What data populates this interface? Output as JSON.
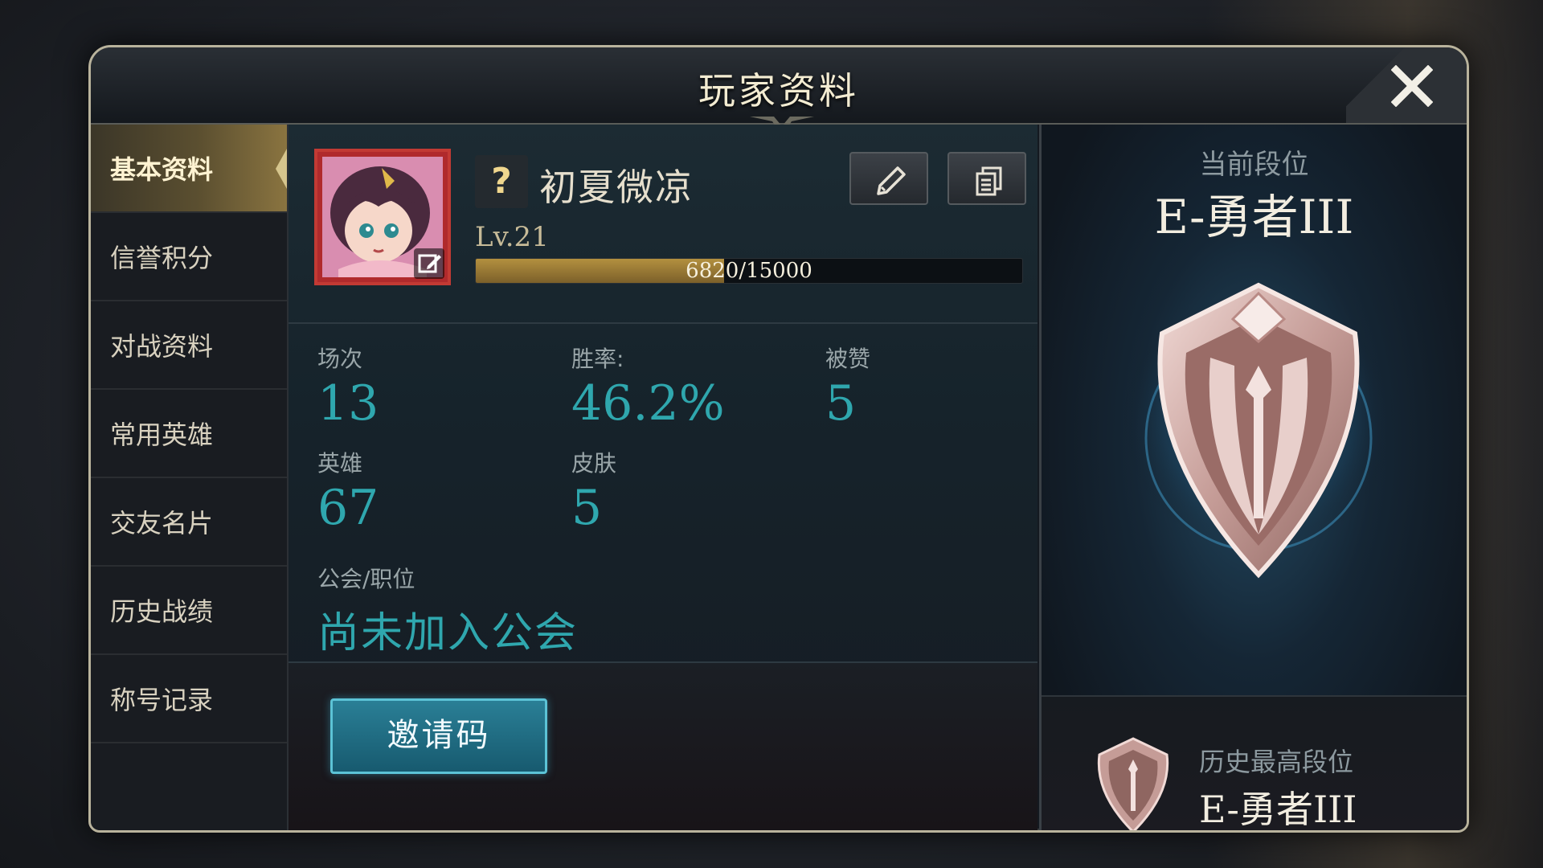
{
  "dialog": {
    "title": "玩家资料",
    "close_icon": "close-icon"
  },
  "sidebar": {
    "items": [
      {
        "label": "基本资料",
        "active": true
      },
      {
        "label": "信誉积分",
        "active": false
      },
      {
        "label": "对战资料",
        "active": false
      },
      {
        "label": "常用英雄",
        "active": false
      },
      {
        "label": "交友名片",
        "active": false
      },
      {
        "label": "历史战绩",
        "active": false
      },
      {
        "label": "称号记录",
        "active": false
      }
    ]
  },
  "profile": {
    "help_badge": "?",
    "name": "初夏微凉",
    "level": "Lv.21",
    "xp_text": "6820/15000",
    "xp_current": 6820,
    "xp_max": 15000
  },
  "stats": {
    "matches_label": "场次",
    "matches_value": "13",
    "winrate_label": "胜率:",
    "winrate_value": "46.2%",
    "likes_label": "被赞",
    "likes_value": "5",
    "heroes_label": "英雄",
    "heroes_value": "67",
    "skins_label": "皮肤",
    "skins_value": "5",
    "guild_label": "公会/职位",
    "guild_value": "尚未加入公会"
  },
  "invite": {
    "label": "邀请码"
  },
  "rank": {
    "current_label": "当前段位",
    "current_value": "E-勇者III",
    "history_label": "历史最高段位",
    "history_value": "E-勇者III"
  },
  "colors": {
    "accent_teal": "#2fa7ae",
    "gold": "#b3903f",
    "avatar_border": "#c23a34"
  }
}
